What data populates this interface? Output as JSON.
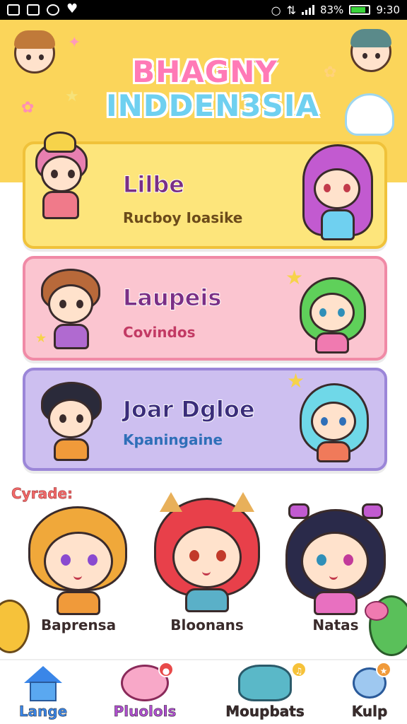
{
  "status_bar": {
    "battery_percent": "83%",
    "battery_level": 0.83,
    "time": "9:30"
  },
  "header": {
    "title_line1": "BHAGNY",
    "title_line2": "INDDEN3SIA"
  },
  "cards": [
    {
      "title": "Lilbe",
      "subtitle": "Rucboy Ioasike"
    },
    {
      "title": "Laupeis",
      "subtitle": "Covindos"
    },
    {
      "title": "Joar Dgloe",
      "subtitle": "Kpaningaine"
    }
  ],
  "section": {
    "label": "Cyrade:"
  },
  "characters": [
    {
      "name": "Baprensa"
    },
    {
      "name": "Bloonans"
    },
    {
      "name": "Natas"
    }
  ],
  "bottom_nav": [
    {
      "label": "Lange",
      "icon": "home-icon",
      "color": "#3a86e8"
    },
    {
      "label": "Pluolols",
      "icon": "pig-icon",
      "color": "#b04fd0"
    },
    {
      "label": "Moupbats",
      "icon": "cat-icon",
      "color": "#3a2b2b"
    },
    {
      "label": "Kulp",
      "icon": "wand-icon",
      "color": "#3a2b2b"
    }
  ],
  "colors": {
    "header_bg": "#fbd55a",
    "card1": "#fde57b",
    "card2": "#fbc5d0",
    "card3": "#cdbff0"
  }
}
